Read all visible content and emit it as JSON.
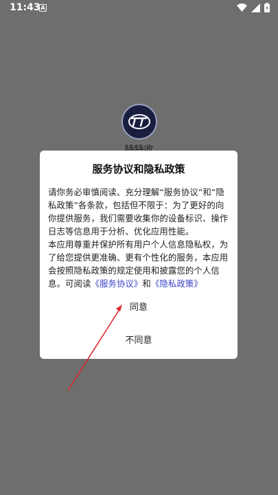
{
  "status_bar": {
    "time": "11:43",
    "app_icon_letter": "A"
  },
  "app": {
    "name": "特特收"
  },
  "dialog": {
    "title": "服务协议和隐私政策",
    "para1": "请你务必审慎阅读、充分理解“服务协议”和“隐私政策”各条款，包括但不限于：为了更好的向你提供服务，我们需要收集你的设备标识、操作日志等信息用于分析、优化应用性能。",
    "para2_prefix": "本应用尊重并保护所有用户个人信息隐私权，为了给您提供更准确、更有个性化的服务，本应用会按照隐私政策的规定使用和披露您的个人信息。可阅读",
    "service_link": "《服务协议》",
    "and_text": "和",
    "privacy_link": "《隐私政策》",
    "agree_label": "同意",
    "disagree_label": "不同意"
  },
  "colors": {
    "overlay": "#6e6e6e",
    "link": "#3a44c8",
    "arrow": "#e0282e"
  }
}
